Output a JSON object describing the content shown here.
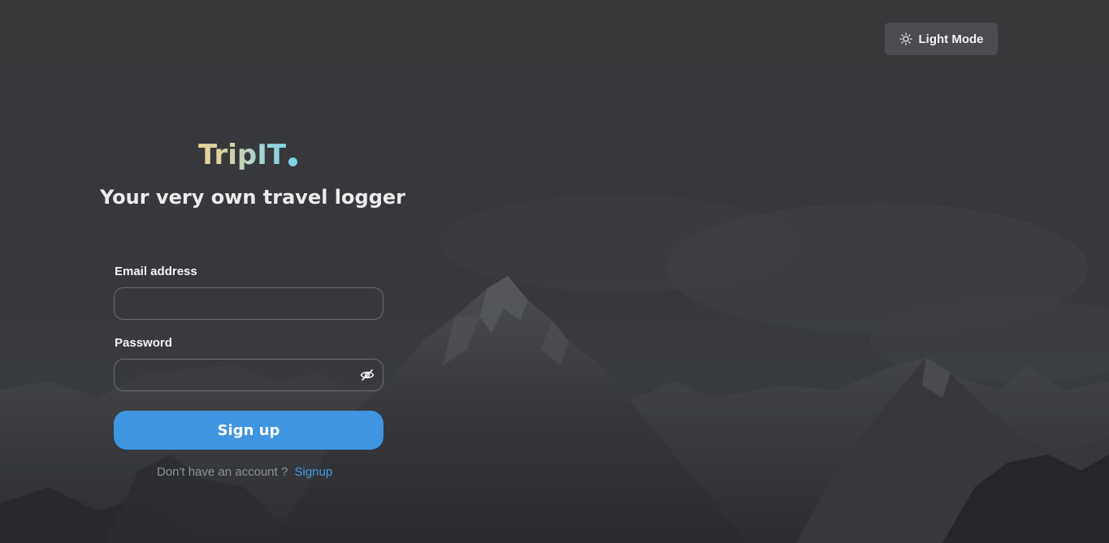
{
  "theme_toggle": {
    "label": "Light Mode",
    "icon": "sun-icon"
  },
  "brand": {
    "name": "TripIT",
    "tagline": "Your very own travel logger"
  },
  "form": {
    "email_label": "Email address",
    "email_value": "",
    "password_label": "Password",
    "password_value": "",
    "password_toggle_icon": "eye-slash-icon",
    "submit_label": "Sign up"
  },
  "footer": {
    "prompt": "Don't have an account ?",
    "link_label": "Signup"
  },
  "colors": {
    "accent": "#3f95e0",
    "link": "#4a9be0",
    "brand_dot": "#7fd3e4",
    "background": "#3a3b3e"
  }
}
